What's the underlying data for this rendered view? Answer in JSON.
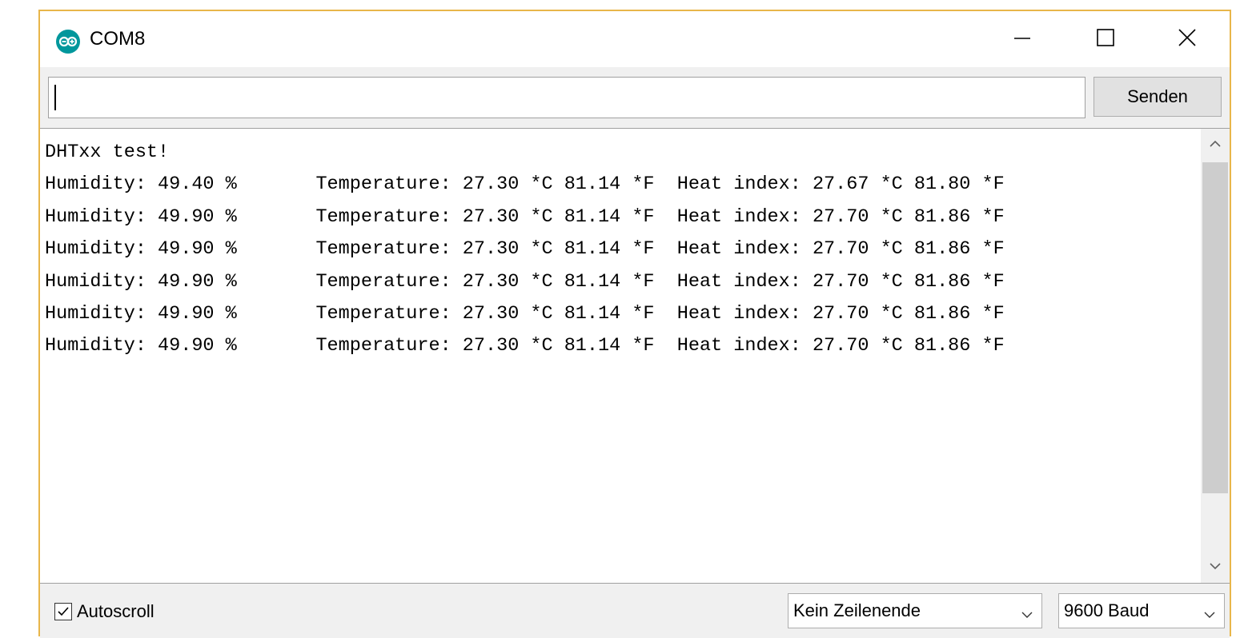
{
  "window": {
    "title": "COM8",
    "icon": "arduino-icon",
    "controls": [
      "minimize-icon",
      "maximize-icon",
      "close-icon"
    ]
  },
  "toolbar": {
    "input_value": "",
    "send_label": "Senden"
  },
  "output": {
    "lines": [
      "DHTxx test!",
      "Humidity: 49.40 %\tTemperature: 27.30 *C 81.14 *F\tHeat index: 27.67 *C 81.80 *F",
      "Humidity: 49.90 %\tTemperature: 27.30 *C 81.14 *F\tHeat index: 27.70 *C 81.86 *F",
      "Humidity: 49.90 %\tTemperature: 27.30 *C 81.14 *F\tHeat index: 27.70 *C 81.86 *F",
      "Humidity: 49.90 %\tTemperature: 27.30 *C 81.14 *F\tHeat index: 27.70 *C 81.86 *F",
      "Humidity: 49.90 %\tTemperature: 27.30 *C 81.14 *F\tHeat index: 27.70 *C 81.86 *F",
      "Humidity: 49.90 %\tTemperature: 27.30 *C 81.14 *F\tHeat index: 27.70 *C 81.86 *F"
    ]
  },
  "status": {
    "autoscroll_label": "Autoscroll",
    "autoscroll_checked": true,
    "line_ending": "Kein Zeilenende",
    "baud": "9600 Baud"
  },
  "colors": {
    "window_border": "#e8b64a",
    "arduino_teal": "#00979c"
  }
}
